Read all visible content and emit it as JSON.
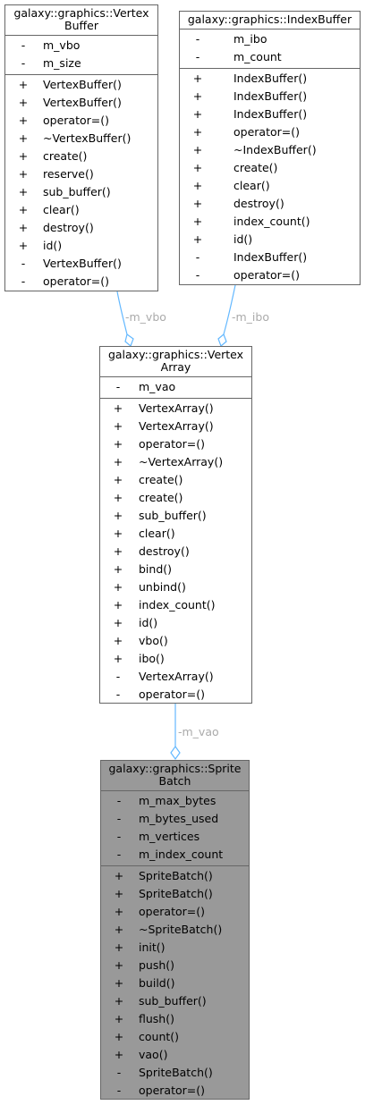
{
  "colors": {
    "edge": "#63b8ff",
    "edge_label": "#aaaaaa",
    "border": "#666666",
    "highlight_fill": "#999999"
  },
  "classes": {
    "vertex_buffer": {
      "title": [
        "galaxy::graphics::Vertex",
        "Buffer"
      ],
      "attributes": [
        {
          "vis": "-",
          "name": "m_vbo"
        },
        {
          "vis": "-",
          "name": "m_size"
        }
      ],
      "methods": [
        {
          "vis": "+",
          "name": "VertexBuffer()"
        },
        {
          "vis": "+",
          "name": "VertexBuffer()"
        },
        {
          "vis": "+",
          "name": "operator=()"
        },
        {
          "vis": "+",
          "name": "~VertexBuffer()"
        },
        {
          "vis": "+",
          "name": "create()"
        },
        {
          "vis": "+",
          "name": "reserve()"
        },
        {
          "vis": "+",
          "name": "sub_buffer()"
        },
        {
          "vis": "+",
          "name": "clear()"
        },
        {
          "vis": "+",
          "name": "destroy()"
        },
        {
          "vis": "+",
          "name": "id()"
        },
        {
          "vis": "-",
          "name": "VertexBuffer()"
        },
        {
          "vis": "-",
          "name": "operator=()"
        }
      ]
    },
    "index_buffer": {
      "title": [
        "galaxy::graphics::IndexBuffer"
      ],
      "attributes": [
        {
          "vis": "-",
          "name": "m_ibo"
        },
        {
          "vis": "-",
          "name": "m_count"
        }
      ],
      "methods": [
        {
          "vis": "+",
          "name": "IndexBuffer()"
        },
        {
          "vis": "+",
          "name": "IndexBuffer()"
        },
        {
          "vis": "+",
          "name": "IndexBuffer()"
        },
        {
          "vis": "+",
          "name": "operator=()"
        },
        {
          "vis": "+",
          "name": "~IndexBuffer()"
        },
        {
          "vis": "+",
          "name": "create()"
        },
        {
          "vis": "+",
          "name": "clear()"
        },
        {
          "vis": "+",
          "name": "destroy()"
        },
        {
          "vis": "+",
          "name": "index_count()"
        },
        {
          "vis": "+",
          "name": "id()"
        },
        {
          "vis": "-",
          "name": "IndexBuffer()"
        },
        {
          "vis": "-",
          "name": "operator=()"
        }
      ]
    },
    "vertex_array": {
      "title": [
        "galaxy::graphics::Vertex",
        "Array"
      ],
      "attributes": [
        {
          "vis": "-",
          "name": "m_vao"
        }
      ],
      "methods": [
        {
          "vis": "+",
          "name": "VertexArray()"
        },
        {
          "vis": "+",
          "name": "VertexArray()"
        },
        {
          "vis": "+",
          "name": "operator=()"
        },
        {
          "vis": "+",
          "name": "~VertexArray()"
        },
        {
          "vis": "+",
          "name": "create()"
        },
        {
          "vis": "+",
          "name": "create()"
        },
        {
          "vis": "+",
          "name": "sub_buffer()"
        },
        {
          "vis": "+",
          "name": "clear()"
        },
        {
          "vis": "+",
          "name": "destroy()"
        },
        {
          "vis": "+",
          "name": "bind()"
        },
        {
          "vis": "+",
          "name": "unbind()"
        },
        {
          "vis": "+",
          "name": "index_count()"
        },
        {
          "vis": "+",
          "name": "id()"
        },
        {
          "vis": "+",
          "name": "vbo()"
        },
        {
          "vis": "+",
          "name": "ibo()"
        },
        {
          "vis": "-",
          "name": "VertexArray()"
        },
        {
          "vis": "-",
          "name": "operator=()"
        }
      ]
    },
    "sprite_batch": {
      "title": [
        "galaxy::graphics::Sprite",
        "Batch"
      ],
      "attributes": [
        {
          "vis": "-",
          "name": "m_max_bytes"
        },
        {
          "vis": "-",
          "name": "m_bytes_used"
        },
        {
          "vis": "-",
          "name": "m_vertices"
        },
        {
          "vis": "-",
          "name": "m_index_count"
        }
      ],
      "methods": [
        {
          "vis": "+",
          "name": "SpriteBatch()"
        },
        {
          "vis": "+",
          "name": "SpriteBatch()"
        },
        {
          "vis": "+",
          "name": "operator=()"
        },
        {
          "vis": "+",
          "name": "~SpriteBatch()"
        },
        {
          "vis": "+",
          "name": "init()"
        },
        {
          "vis": "+",
          "name": "push()"
        },
        {
          "vis": "+",
          "name": "build()"
        },
        {
          "vis": "+",
          "name": "sub_buffer()"
        },
        {
          "vis": "+",
          "name": "flush()"
        },
        {
          "vis": "+",
          "name": "count()"
        },
        {
          "vis": "+",
          "name": "vao()"
        },
        {
          "vis": "-",
          "name": "SpriteBatch()"
        },
        {
          "vis": "-",
          "name": "operator=()"
        }
      ]
    }
  },
  "edges": [
    {
      "label": "-m_vbo"
    },
    {
      "label": "-m_ibo"
    },
    {
      "label": "-m_vao"
    }
  ]
}
